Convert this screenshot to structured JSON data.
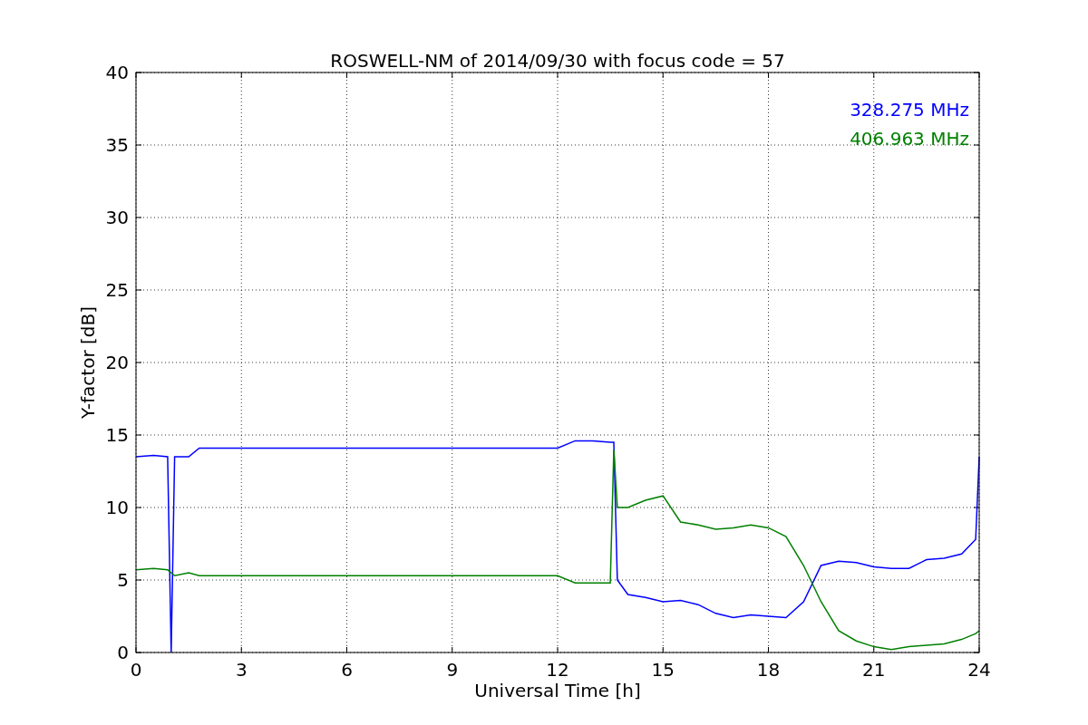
{
  "figure": {
    "chart_data": {
      "type": "line",
      "title": "ROSWELL-NM of 2014/09/30 with focus code = 57",
      "xlabel": "Universal Time [h]",
      "ylabel": "Y-factor [dB]",
      "x": [
        0,
        0.5,
        0.9,
        1.0,
        1.1,
        1.5,
        1.8,
        3,
        6,
        9,
        12,
        12.5,
        13,
        13.5,
        13.6,
        13.7,
        14,
        14.5,
        15,
        15.5,
        16,
        16.5,
        17,
        17.5,
        18,
        18.5,
        19,
        19.5,
        20,
        20.5,
        21,
        21.5,
        22,
        22.5,
        23,
        23.5,
        23.9,
        24
      ],
      "series": [
        {
          "name": "328.275 MHz",
          "color": "#0000ff",
          "values": [
            13.5,
            13.6,
            13.5,
            0,
            13.5,
            13.5,
            14.1,
            14.1,
            14.1,
            14.1,
            14.1,
            14.6,
            14.6,
            14.5,
            14.5,
            5,
            4,
            3.8,
            3.5,
            3.6,
            3.3,
            2.7,
            2.4,
            2.6,
            2.5,
            2.4,
            3.5,
            6,
            6.3,
            6.2,
            5.9,
            5.8,
            5.8,
            6.4,
            6.5,
            6.8,
            7.8,
            13.5
          ]
        },
        {
          "name": "406.963 MHz",
          "color": "#008000",
          "values": [
            5.7,
            5.8,
            5.7,
            5.5,
            5.3,
            5.5,
            5.3,
            5.3,
            5.3,
            5.3,
            5.3,
            4.8,
            4.8,
            4.8,
            14,
            10,
            10,
            10.5,
            10.8,
            9,
            8.8,
            8.5,
            8.6,
            8.8,
            8.6,
            8,
            6,
            3.5,
            1.5,
            0.8,
            0.4,
            0.2,
            0.4,
            0.5,
            0.6,
            0.9,
            1.3,
            1.5
          ]
        }
      ],
      "xlim": [
        0,
        24
      ],
      "ylim": [
        0,
        40
      ],
      "xticks": [
        0,
        3,
        6,
        9,
        12,
        15,
        18,
        21,
        24
      ],
      "yticks": [
        0,
        5,
        10,
        15,
        20,
        25,
        30,
        35,
        40
      ],
      "grid": true
    }
  }
}
